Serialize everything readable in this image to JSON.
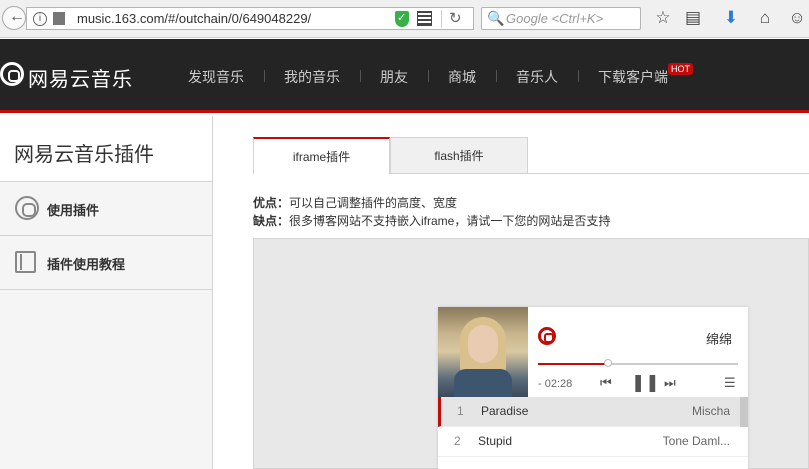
{
  "browser": {
    "url": "music.163.com/#/outchain/0/649048229/",
    "search_placeholder": "Google <Ctrl+K>"
  },
  "header": {
    "logo_text": "网易云音乐",
    "nav": [
      "发现音乐",
      "我的音乐",
      "朋友",
      "商城",
      "音乐人",
      "下载客户端"
    ],
    "hot_badge": "HOT",
    "accent_color": "#c20c0c"
  },
  "sidebar": {
    "title": "网易云音乐插件",
    "items": [
      {
        "label": "使用插件",
        "icon": "gear-icon"
      },
      {
        "label": "插件使用教程",
        "icon": "book-icon"
      }
    ]
  },
  "main": {
    "tabs": [
      {
        "label": "iframe插件",
        "active": true
      },
      {
        "label": "flash插件",
        "active": false
      }
    ],
    "pros_label": "优点：",
    "pros_text": "可以自己调整插件的高度、宽度",
    "cons_label": "缺点：",
    "cons_text": "很多博客网站不支持嵌入iframe，请试一下您的网站是否支持"
  },
  "player": {
    "title": "绵绵",
    "time": "- 02:28",
    "progress": 0.35,
    "tracks": [
      {
        "num": "1",
        "name": "Paradise",
        "artist": "Mischa",
        "active": true
      },
      {
        "num": "2",
        "name": "Stupid",
        "artist": "Tone Daml...",
        "active": false
      }
    ]
  }
}
